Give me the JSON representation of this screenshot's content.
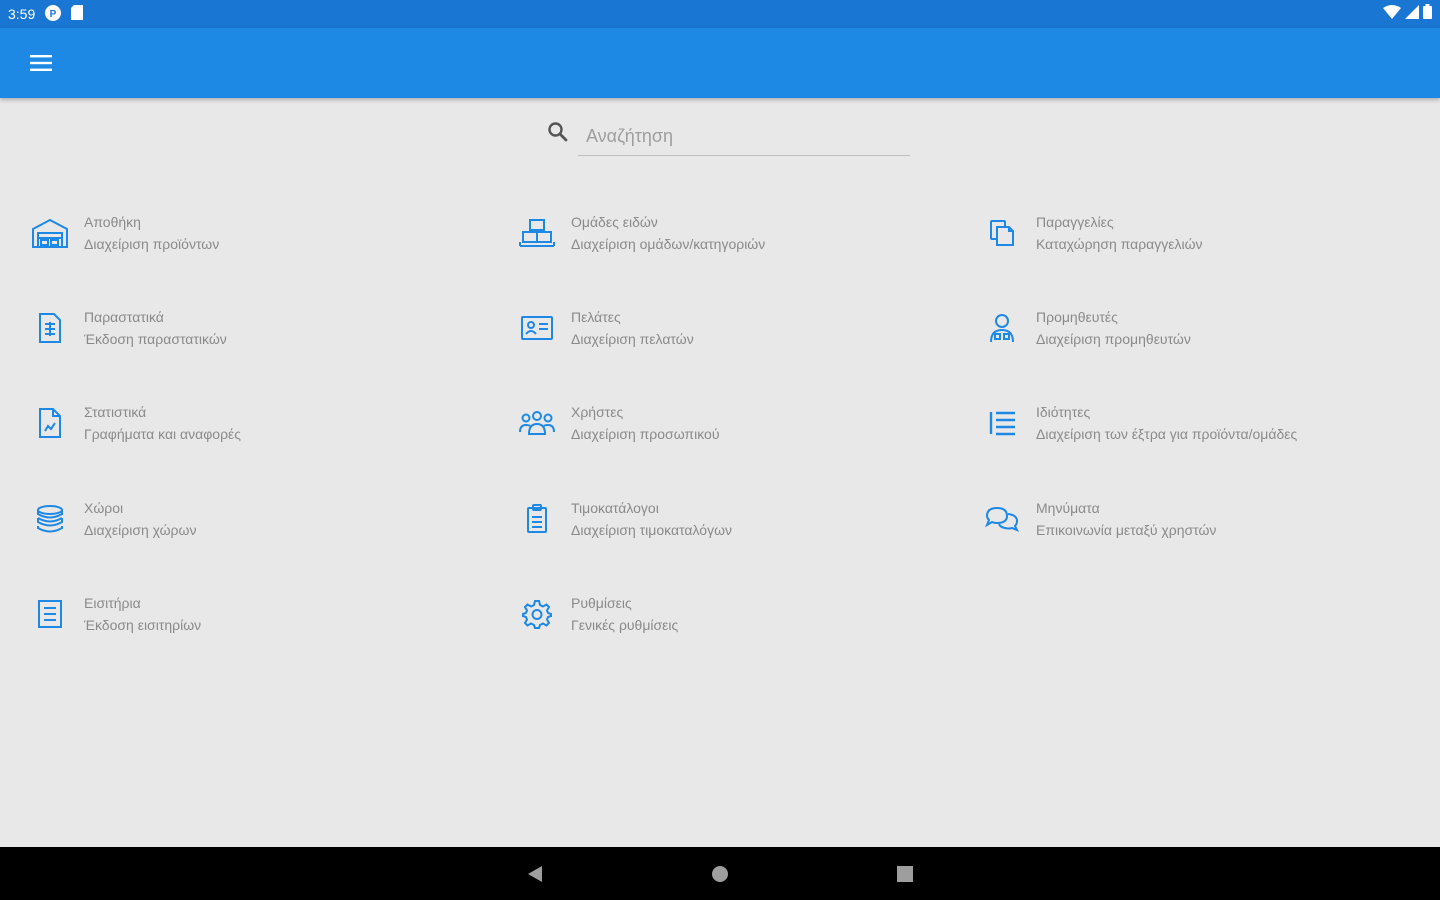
{
  "status": {
    "time": "3:59"
  },
  "search": {
    "placeholder": "Αναζήτηση",
    "value": ""
  },
  "accent": "#1e88e5",
  "menu": [
    {
      "title": "Αποθήκη",
      "subtitle": "Διαχείριση προϊόντων",
      "icon": "warehouse-icon"
    },
    {
      "title": "Ομάδες ειδών",
      "subtitle": "Διαχείριση ομάδων/κατηγοριών",
      "icon": "groups-boxes-icon"
    },
    {
      "title": "Παραγγελίες",
      "subtitle": "Καταχώρηση παραγγελιών",
      "icon": "orders-copy-icon"
    },
    {
      "title": "Παραστατικά",
      "subtitle": "Έκδοση παραστατικών",
      "icon": "invoice-icon"
    },
    {
      "title": "Πελάτες",
      "subtitle": "Διαχείριση πελατών",
      "icon": "contact-card-icon"
    },
    {
      "title": "Προμηθευτές",
      "subtitle": "Διαχείριση προμηθευτών",
      "icon": "supplier-icon"
    },
    {
      "title": "Στατιστικά",
      "subtitle": "Γραφήματα και αναφορές",
      "icon": "report-file-icon"
    },
    {
      "title": "Χρήστες",
      "subtitle": "Διαχείριση προσωπικού",
      "icon": "users-icon"
    },
    {
      "title": "Ιδιότητες",
      "subtitle": "Διαχείριση των έξτρα για προϊόντα/ομάδες",
      "icon": "list-icon"
    },
    {
      "title": "Χώροι",
      "subtitle": "Διαχείριση χώρων",
      "icon": "layers-icon"
    },
    {
      "title": "Τιμοκατάλογοι",
      "subtitle": "Διαχείριση τιμοκαταλόγων",
      "icon": "clipboard-icon"
    },
    {
      "title": "Μηνύματα",
      "subtitle": "Επικοινωνία μεταξύ χρηστών",
      "icon": "chat-icon"
    },
    {
      "title": "Εισιτήρια",
      "subtitle": "Έκδοση εισιτηρίων",
      "icon": "ticket-icon"
    },
    {
      "title": "Ρυθμίσεις",
      "subtitle": "Γενικές ρυθμίσεις",
      "icon": "settings-gear-icon"
    }
  ]
}
